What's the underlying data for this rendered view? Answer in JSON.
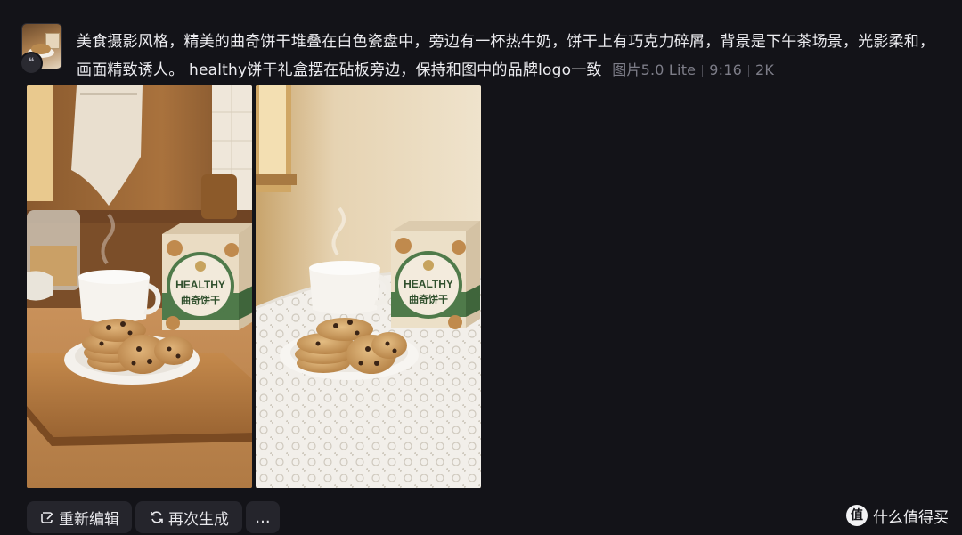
{
  "message": {
    "prompt": "美食摄影风格，精美的曲奇饼干堆叠在白色瓷盘中，旁边有一杯热牛奶，饼干上有巧克力碎屑，背景是下午茶场景，光影柔和，画面精致诱人。 healthy饼干礼盒摆在砧板旁边，保持和图中的品牌logo一致",
    "model": "图片5.0 Lite",
    "ratio": "9:16",
    "resolution": "2K"
  },
  "product": {
    "brand": "HEALTHY",
    "name": "曲奇饼干"
  },
  "actions": {
    "edit_label": "重新编辑",
    "regenerate_label": "再次生成",
    "more_label": "..."
  },
  "watermark": {
    "icon_text": "值",
    "text": "什么值得买"
  },
  "colors": {
    "background": "#131318",
    "button": "#25252c",
    "meta_text": "#7d7d88",
    "box_green": "#4f7a4a"
  }
}
